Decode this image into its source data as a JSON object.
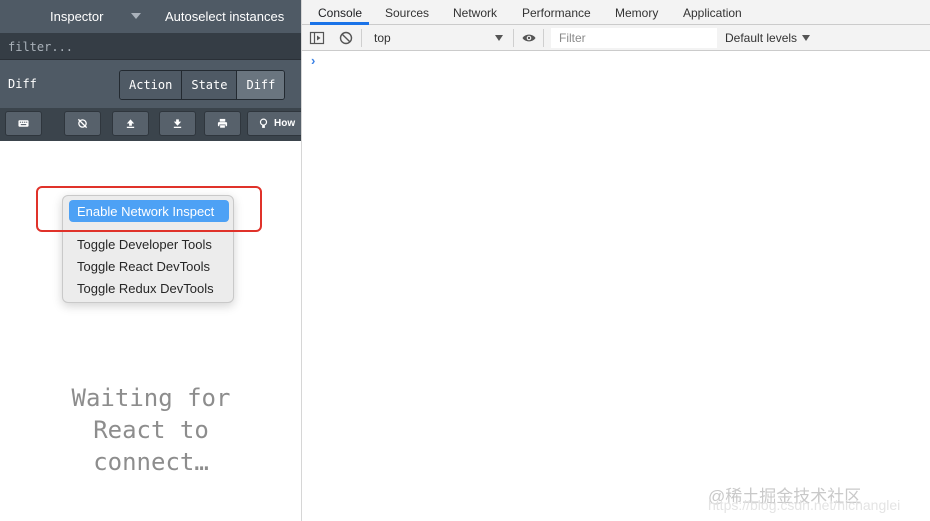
{
  "redux_devtools": {
    "header": {
      "inspector_label": "Inspector",
      "autoselect_label": "Autoselect instances"
    },
    "filter": {
      "placeholder": "filter..."
    },
    "diff_row": {
      "title": "Diff",
      "tabs": [
        {
          "label": "Action"
        },
        {
          "label": "State"
        },
        {
          "label": "Diff",
          "active": true
        }
      ]
    },
    "toolbar": {
      "buttons": [
        {
          "icon": "keyboard-icon"
        },
        {
          "icon": "no-sync-icon"
        },
        {
          "icon": "upload-icon"
        },
        {
          "icon": "download-icon"
        },
        {
          "icon": "print-icon"
        },
        {
          "icon": "lightbulb-icon",
          "label": "How"
        }
      ]
    },
    "context_menu": {
      "items": [
        {
          "label": "Enable Network Inspect",
          "highlighted": true
        },
        {
          "label": "Toggle Developer Tools"
        },
        {
          "label": "Toggle React DevTools"
        },
        {
          "label": "Toggle Redux DevTools"
        }
      ]
    },
    "waiting_message": [
      "Waiting for",
      "React to",
      "connect…"
    ]
  },
  "chrome_devtools": {
    "tabs": [
      {
        "label": "Console",
        "active": true
      },
      {
        "label": "Sources"
      },
      {
        "label": "Network"
      },
      {
        "label": "Performance"
      },
      {
        "label": "Memory"
      },
      {
        "label": "Application"
      }
    ],
    "toolbar": {
      "context": "top",
      "filter_placeholder": "Filter",
      "levels": "Default levels"
    },
    "console": {
      "prompt": "›"
    }
  },
  "watermark": {
    "text": "@稀土掘金技术社区",
    "url": "https://blog.csdn.net/nichanglei"
  },
  "colors": {
    "dark_header": "#4f5a65",
    "menu_highlight": "#4da1f5",
    "annotation_red": "#e0322a",
    "tab_accent": "#1a73e8"
  }
}
